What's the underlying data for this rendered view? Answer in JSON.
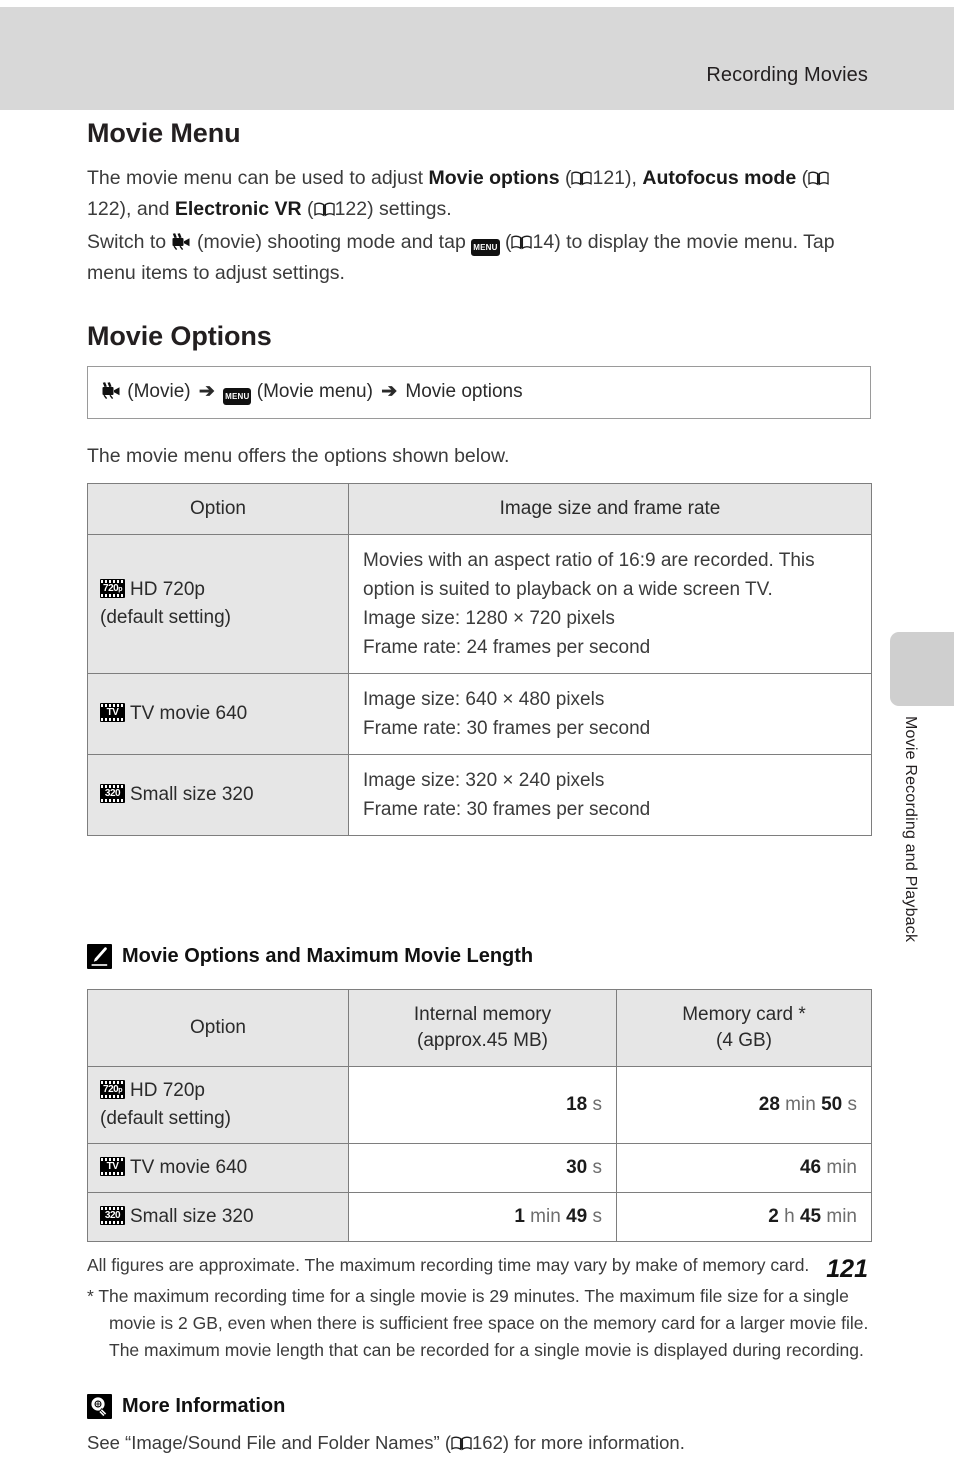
{
  "header": {
    "running_title": "Recording Movies"
  },
  "side_tab": {
    "label": "Movie Recording and Playback"
  },
  "sections": {
    "movie_menu": {
      "heading": "Movie Menu",
      "para1_a": "The movie menu can be used to adjust ",
      "para1_b": "Movie options",
      "para1_c": " (",
      "para1_page1": "121",
      "para1_d": "), ",
      "para1_e": "Autofocus mode",
      "para1_f": " (",
      "para1_page2": "122",
      "para1_g": "), and ",
      "para1_h": "Electronic VR",
      "para1_i": " (",
      "para1_page3": "122",
      "para1_j": ") settings.",
      "para2_a": "Switch to ",
      "para2_b": " (movie) shooting mode and tap ",
      "para2_menu_icon_label": "MENU",
      "para2_c": " (",
      "para2_page": "14",
      "para2_d": ") to display the movie menu. Tap menu items to adjust settings."
    },
    "movie_options": {
      "heading": "Movie Options",
      "path": {
        "step1": "(Movie)",
        "arrow": "➔",
        "step2_icon_label": "MENU",
        "step2": "(Movie menu)",
        "step3": "Movie options"
      },
      "lead": "The movie menu offers the options shown below."
    }
  },
  "table_options": {
    "headers": [
      "Option",
      "Image size and frame rate"
    ],
    "rows": [
      {
        "badge": "720p",
        "badge_main": "720",
        "badge_sub": "p",
        "option_line1": "HD 720p",
        "option_line2": "(default setting)",
        "desc_lines": [
          "Movies with an aspect ratio of 16:9 are recorded. This option is suited to playback on a wide screen TV.",
          "Image size: 1280 × 720 pixels",
          "Frame rate: 24 frames per second"
        ]
      },
      {
        "badge": "TV",
        "badge_main": "TV",
        "badge_sub": "",
        "option_line1": "TV movie 640",
        "option_line2": "",
        "desc_lines": [
          "Image size: 640 × 480 pixels",
          "Frame rate: 30 frames per second"
        ]
      },
      {
        "badge": "320",
        "badge_main": "320",
        "badge_sub": "",
        "option_line1": "Small size 320",
        "option_line2": "",
        "desc_lines": [
          "Image size: 320 × 240 pixels",
          "Frame rate: 30 frames per second"
        ]
      }
    ]
  },
  "note_length": {
    "icon": "pencil-note-icon",
    "heading": "Movie Options and Maximum Movie Length",
    "headers": {
      "col1": "Option",
      "col2_line1": "Internal memory",
      "col2_line2": "(approx.45 MB)",
      "col3_line1": "Memory card *",
      "col3_line2": "(4 GB)"
    },
    "rows": [
      {
        "badge_main": "720",
        "badge_sub": "p",
        "option_line1": "HD 720p",
        "option_line2": "(default setting)",
        "internal": [
          {
            "v": "18",
            "u": "s"
          }
        ],
        "card": [
          {
            "v": "28",
            "u": "min"
          },
          {
            "v": "50",
            "u": "s"
          }
        ]
      },
      {
        "badge_main": "TV",
        "badge_sub": "",
        "option_line1": "TV movie 640",
        "option_line2": "",
        "internal": [
          {
            "v": "30",
            "u": "s"
          }
        ],
        "card": [
          {
            "v": "46",
            "u": "min"
          }
        ]
      },
      {
        "badge_main": "320",
        "badge_sub": "",
        "option_line1": "Small size 320",
        "option_line2": "",
        "internal": [
          {
            "v": "1",
            "u": "min"
          },
          {
            "v": "49",
            "u": "s"
          }
        ],
        "card": [
          {
            "v": "2",
            "u": "h"
          },
          {
            "v": "45",
            "u": "min"
          }
        ]
      }
    ],
    "footnote_general": "All figures are approximate. The maximum recording time may vary by make of memory card.",
    "footnote_star": "*  The maximum recording time for a single movie is 29 minutes. The maximum file size for a single movie is 2 GB, even when there is sufficient free space on the memory card for a larger movie file. The maximum movie length that can be recorded for a single movie is displayed during recording."
  },
  "note_more_info": {
    "icon": "lightbulb-note-icon",
    "heading": "More Information",
    "text_a": "See “Image/Sound File and Folder Names” (",
    "page": "162",
    "text_b": ") for more information."
  },
  "page_number": "121"
}
